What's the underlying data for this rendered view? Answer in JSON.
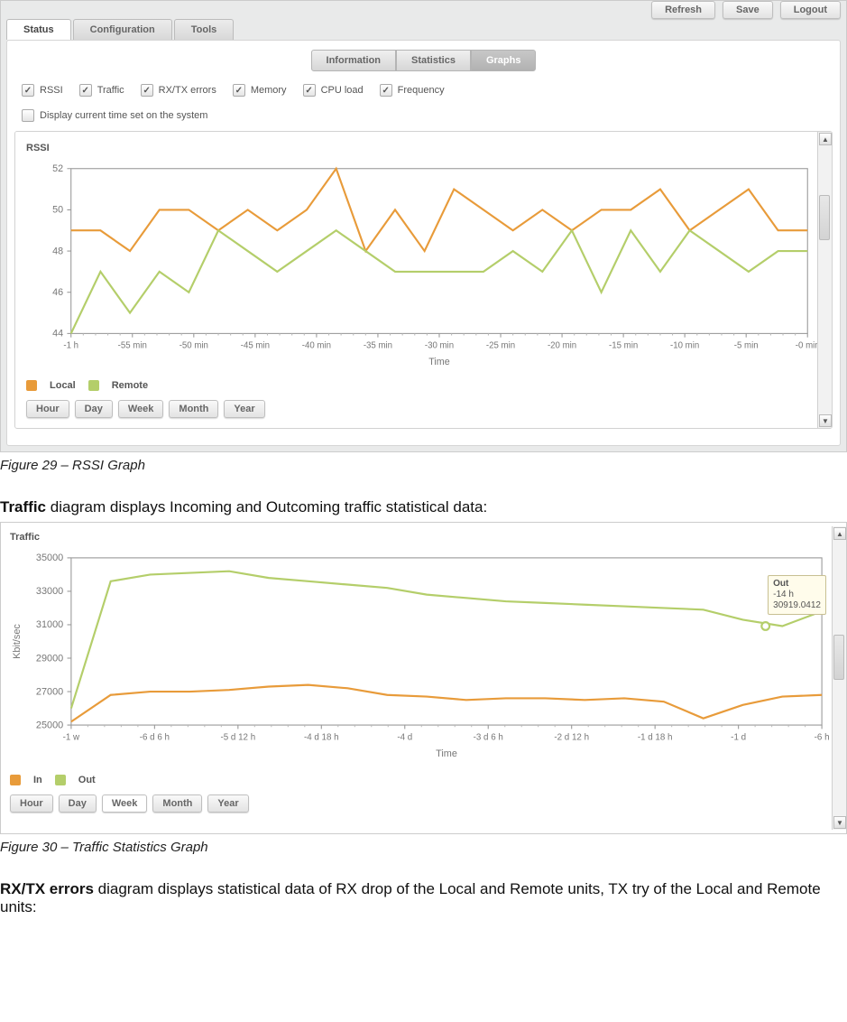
{
  "topbar": {
    "refresh": "Refresh",
    "save": "Save",
    "logout": "Logout"
  },
  "tabs": {
    "status": "Status",
    "config": "Configuration",
    "tools": "Tools"
  },
  "subtabs": {
    "info": "Information",
    "stats": "Statistics",
    "graphs": "Graphs"
  },
  "checks": {
    "rssi": "RSSI",
    "traffic": "Traffic",
    "rxtx": "RX/TX errors",
    "memory": "Memory",
    "cpu": "CPU load",
    "freq": "Frequency",
    "timecheck": "Display current time set on the system"
  },
  "chart1": {
    "title": "RSSI",
    "xlabel": "Time",
    "legend": {
      "local": "Local",
      "remote": "Remote"
    }
  },
  "chart2": {
    "title": "Traffic",
    "ylabel": "Kbit/sec",
    "xlabel": "Time",
    "legend": {
      "in": "In",
      "out": "Out"
    }
  },
  "tooltip": {
    "l1": "Out",
    "l2": "-14 h",
    "l3": "30919.0412"
  },
  "range": {
    "hour": "Hour",
    "day": "Day",
    "week": "Week",
    "month": "Month",
    "year": "Year"
  },
  "caption1": "Figure 29 – RSSI Graph",
  "para_traffic_b": "Traffic",
  "para_traffic_r": " diagram displays Incoming and Outcoming traffic statistical data:",
  "caption2": "Figure 30 – Traffic Statistics Graph",
  "para_rxtx_b": "RX/TX errors",
  "para_rxtx_r": " diagram displays statistical data of RX drop of the Local and Remote units, TX try of the Local and Remote units:",
  "colors": {
    "orange": "#e89b3a",
    "green": "#b4ce6a"
  },
  "chart_data": [
    {
      "type": "line",
      "title": "RSSI",
      "xlabel": "Time",
      "ylabel": "",
      "ylim": [
        44,
        52
      ],
      "yticks": [
        44,
        46,
        48,
        50,
        52
      ],
      "categories": [
        "-1 h",
        "-55 min",
        "-50 min",
        "-45 min",
        "-40 min",
        "-35 min",
        "-30 min",
        "-25 min",
        "-20 min",
        "-15 min",
        "-10 min",
        "-5 min",
        "-0 min"
      ],
      "series": [
        {
          "name": "Local",
          "color": "#e89b3a",
          "values": [
            49,
            49,
            48,
            50,
            50,
            49,
            50,
            49,
            50,
            52,
            48,
            50,
            48,
            51,
            50,
            49,
            50,
            49,
            50,
            50,
            51,
            49,
            50,
            51,
            49,
            49
          ]
        },
        {
          "name": "Remote",
          "color": "#b4ce6a",
          "values": [
            44,
            47,
            45,
            47,
            46,
            49,
            48,
            47,
            48,
            49,
            48,
            47,
            47,
            47,
            47,
            48,
            47,
            49,
            46,
            49,
            47,
            49,
            48,
            47,
            48,
            48
          ]
        }
      ]
    },
    {
      "type": "line",
      "title": "Traffic",
      "xlabel": "Time",
      "ylabel": "Kbit/sec",
      "ylim": [
        25000,
        35000
      ],
      "yticks": [
        25000,
        27000,
        29000,
        31000,
        33000,
        35000
      ],
      "categories": [
        "-1 w",
        "-6 d 6 h",
        "-5 d 12 h",
        "-4 d 18 h",
        "-4 d",
        "-3 d 6 h",
        "-2 d 12 h",
        "-1 d 18 h",
        "-1 d",
        "-6 h"
      ],
      "series": [
        {
          "name": "In",
          "color": "#e89b3a",
          "values": [
            25200,
            26800,
            27000,
            27000,
            27100,
            27300,
            27400,
            27200,
            26800,
            26700,
            26500,
            26600,
            26600,
            26500,
            26600,
            26400,
            25400,
            26200,
            26700,
            26800
          ]
        },
        {
          "name": "Out",
          "color": "#b4ce6a",
          "values": [
            26000,
            33600,
            34000,
            34100,
            34200,
            33800,
            33600,
            33400,
            33200,
            32800,
            32600,
            32400,
            32300,
            32200,
            32100,
            32000,
            31900,
            31300,
            30919,
            31800
          ]
        }
      ],
      "annotations": [
        {
          "label": "Out",
          "x": "-14 h",
          "y": 30919.0412
        }
      ]
    }
  ]
}
